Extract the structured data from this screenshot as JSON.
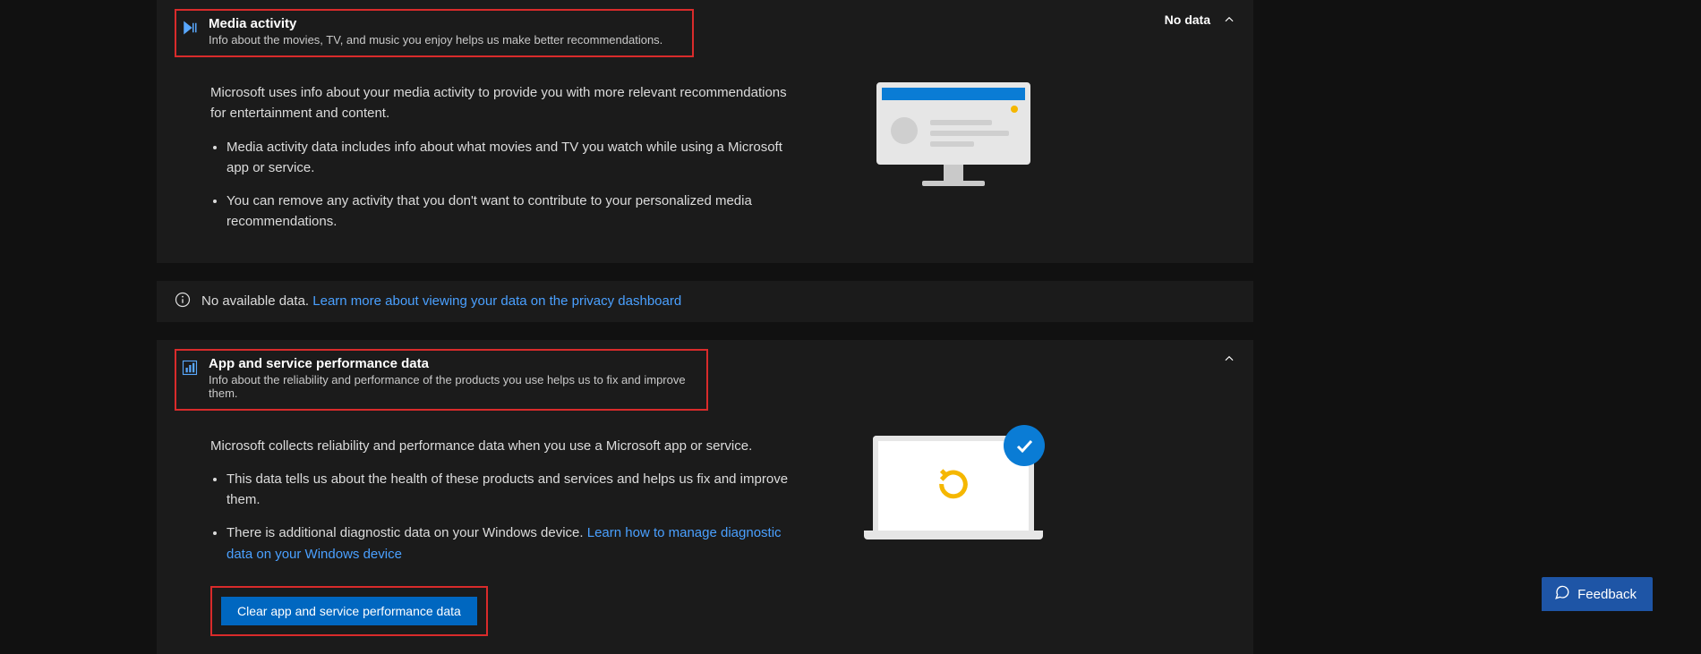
{
  "media": {
    "title": "Media activity",
    "sub": "Info about the movies, TV, and music you enjoy helps us make better recommendations.",
    "status": "No data",
    "para": "Microsoft uses info about your media activity to provide you with more relevant recommendations for entertainment and content.",
    "bullet1": "Media activity data includes info about what movies and TV you watch while using a Microsoft app or service.",
    "bullet2": "You can remove any activity that you don't want to contribute to your personalized media recommendations."
  },
  "notice": {
    "text": "No available data.",
    "link": "Learn more about viewing your data on the privacy dashboard"
  },
  "perf": {
    "title": "App and service performance data",
    "sub": "Info about the reliability and performance of the products you use helps us to fix and improve them.",
    "para": "Microsoft collects reliability and performance data when you use a Microsoft app or service.",
    "bullet1": "This data tells us about the health of these products and services and helps us fix and improve them.",
    "bullet2a": "There is additional diagnostic data on your Windows device. ",
    "bullet2link": "Learn how to manage diagnostic data on your Windows device",
    "clear_btn": "Clear app and service performance data"
  },
  "feedback": {
    "label": "Feedback"
  }
}
